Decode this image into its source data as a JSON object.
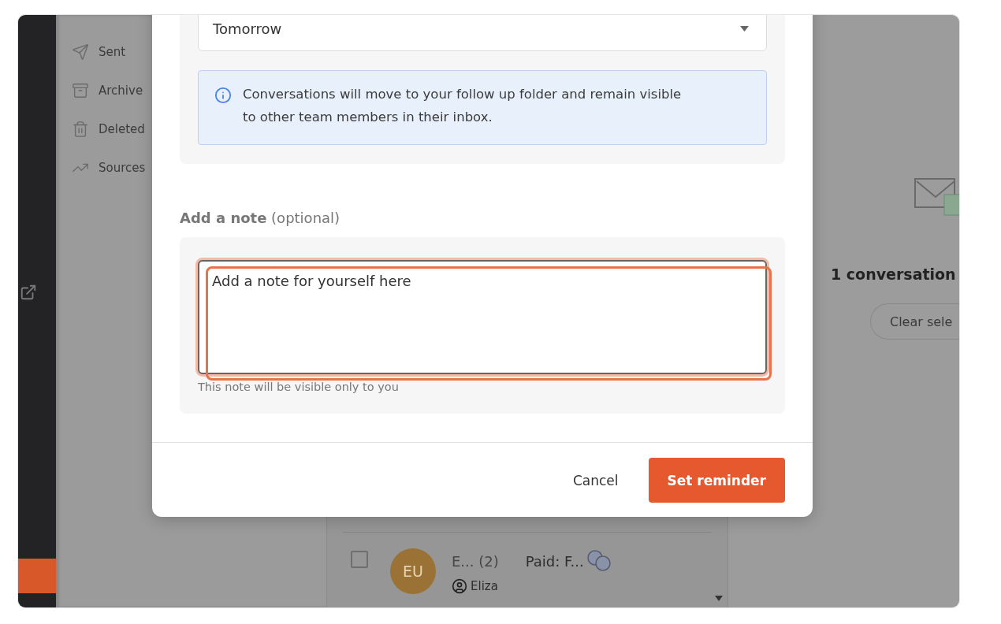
{
  "sidebar": {
    "items": [
      {
        "label": "Sent"
      },
      {
        "label": "Archive"
      },
      {
        "label": "Deleted"
      },
      {
        "label": "Sources"
      }
    ]
  },
  "list": {
    "rows": [
      {
        "checked": false,
        "initials": "EU",
        "color": "#9a7235",
        "sender": "E... (2)",
        "subject": "Paid: F...",
        "assignee": "Eliza"
      }
    ]
  },
  "right_panel": {
    "selection_count": "1 conversation",
    "clear_button": "Clear sele"
  },
  "modal": {
    "dropdown": {
      "value": "Tomorrow"
    },
    "info": "Conversations will move to your follow up folder and remain visible to other team members in their inbox.",
    "note_label": "**Add a note** (optional)",
    "note": {
      "value": "Add a note for yourself here",
      "highlighted": true
    },
    "note_hint": "This note will be visible only to you",
    "buttons": [
      {
        "label": "Cancel",
        "kind": "secondary"
      },
      {
        "label": "Set reminder",
        "kind": "primary"
      }
    ]
  }
}
